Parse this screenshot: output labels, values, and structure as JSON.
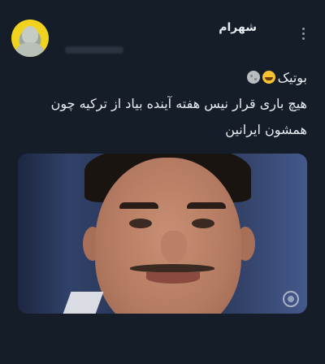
{
  "post": {
    "author_name": "شهرام",
    "line1": "بوتیک",
    "line2": "هیچ باری قرار نیس هفته آینده بیاد از ترکیه چون",
    "line3": "همشون ایرانین",
    "emoji_line1": [
      "grinning-face-with-sweat-icon",
      "new-moon-face-icon"
    ]
  },
  "icons": {
    "more": "more-vertical-icon",
    "watermark": "tv-network-logo"
  },
  "colors": {
    "background": "#151d28",
    "text": "#e7ecf0",
    "muted": "#8b98a5",
    "avatar_ring": "#f1d21f"
  }
}
